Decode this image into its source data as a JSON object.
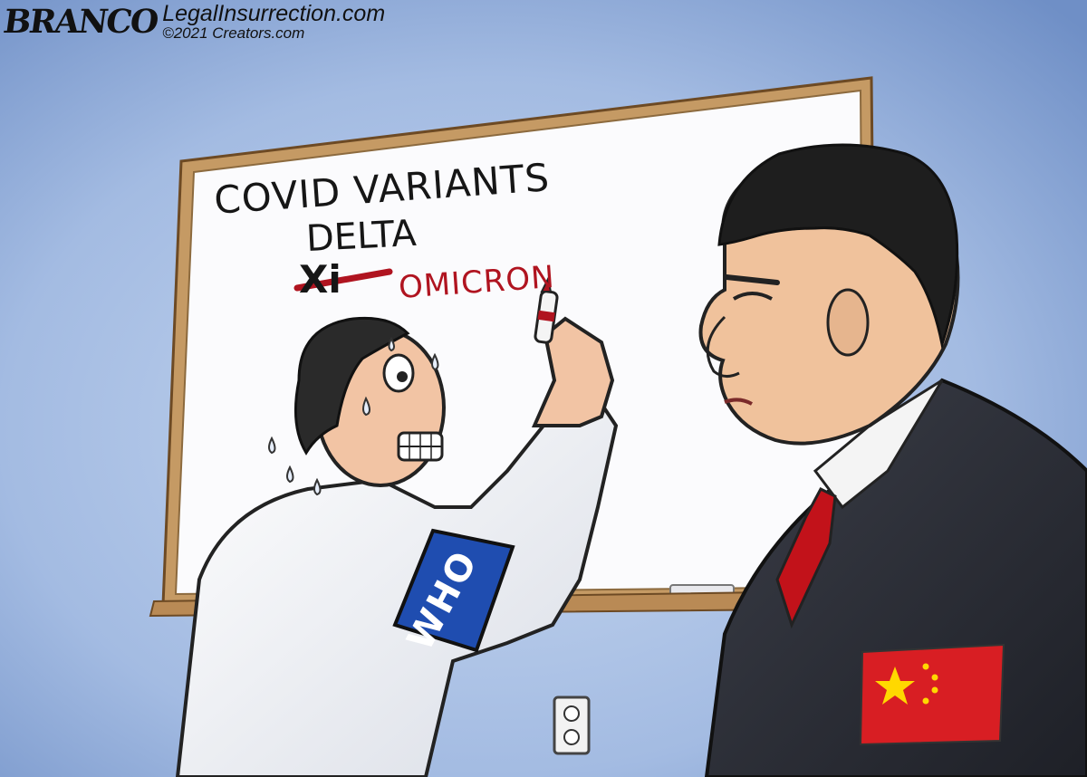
{
  "signature": {
    "brand": "BRANCO",
    "site": "LegalInsurrection.com",
    "copyright": "©2021 Creators.com"
  },
  "whiteboard": {
    "heading": "COVID VARIANTS",
    "line1": "DELTA",
    "crossed_out": "Xi",
    "line2": "OMICRON"
  },
  "armband": {
    "label": "WHO"
  },
  "colors": {
    "background": "#a9c0e4",
    "board_frame": "#b98a55",
    "marker_red": "#b01420",
    "armband_blue": "#1f4db0",
    "suit": "#2e3038",
    "flag_red": "#d81e23",
    "flag_star": "#ffd800"
  }
}
